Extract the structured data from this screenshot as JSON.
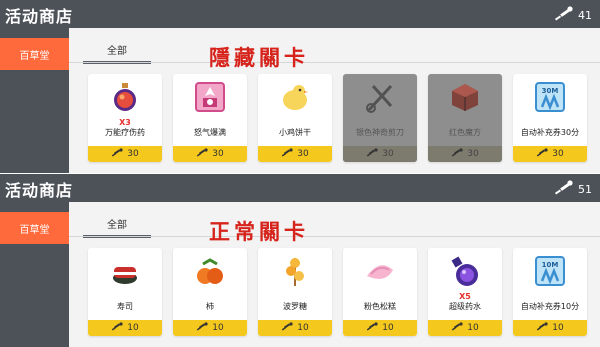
{
  "panels": [
    {
      "title": "活动商店",
      "key_count": "41",
      "sidebar_tab": "百草堂",
      "tab_label": "全部",
      "stamp": "隱藏關卡",
      "items": [
        {
          "name": "万能疗伤药",
          "qty": "X3",
          "price": "30",
          "icon": "potion-icon",
          "disabled": false
        },
        {
          "name": "怒气爆满",
          "qty": "",
          "price": "30",
          "icon": "rage-burst-icon",
          "disabled": false
        },
        {
          "name": "小鸡饼干",
          "qty": "",
          "price": "30",
          "icon": "chick-cookie-icon",
          "disabled": false
        },
        {
          "name": "银色神奇剪刀",
          "qty": "",
          "price": "30",
          "icon": "silver-scissors-icon",
          "disabled": true
        },
        {
          "name": "红色魔方",
          "qty": "",
          "price": "30",
          "icon": "red-cube-icon",
          "disabled": true
        },
        {
          "name": "自动补充券30分",
          "qty": "",
          "price": "30",
          "icon": "auto-refill-30m-icon",
          "icon_text": "30M",
          "disabled": false
        }
      ]
    },
    {
      "title": "活动商店",
      "key_count": "51",
      "sidebar_tab": "百草堂",
      "tab_label": "全部",
      "stamp": "正常關卡",
      "items": [
        {
          "name": "寿司",
          "qty": "",
          "price": "10",
          "icon": "sushi-icon",
          "disabled": false
        },
        {
          "name": "柿",
          "qty": "",
          "price": "10",
          "icon": "persimmon-icon",
          "disabled": false
        },
        {
          "name": "波罗糖",
          "qty": "",
          "price": "10",
          "icon": "candy-skewer-icon",
          "disabled": false
        },
        {
          "name": "粉色松糕",
          "qty": "",
          "price": "10",
          "icon": "pink-cake-icon",
          "disabled": false
        },
        {
          "name": "超级药水",
          "qty": "X5",
          "price": "10",
          "icon": "super-potion-icon",
          "disabled": false
        },
        {
          "name": "自动补充券10分",
          "qty": "",
          "price": "10",
          "icon": "auto-refill-10m-icon",
          "icon_text": "10M",
          "disabled": false
        }
      ]
    }
  ],
  "colors": {
    "header": "#4d5259",
    "sidebar_active": "#ff6a3d",
    "price_bar": "#f4c81c",
    "stamp": "#d6231b",
    "qty": "#e3302a"
  }
}
